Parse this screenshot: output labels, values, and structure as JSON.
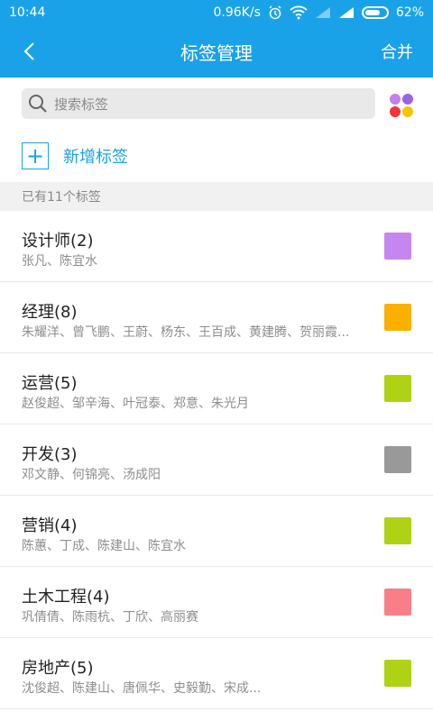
{
  "status_bar": {
    "time": "10:44",
    "speed": "0.96K/s",
    "battery": "62%"
  },
  "header": {
    "title": "标签管理",
    "merge_label": "合并"
  },
  "search": {
    "placeholder": "搜索标签"
  },
  "add": {
    "label": "新增标签"
  },
  "count_text": "已有11个标签",
  "palette": [
    "#c57df0",
    "#9a63e8",
    "#f5313b",
    "#f6c400"
  ],
  "tags": [
    {
      "title": "设计师(2)",
      "members": "张凡、陈宜水",
      "color": "#c586ef"
    },
    {
      "title": "经理(8)",
      "members": "朱耀洋、曾飞鹏、王蔚、杨东、王百成、黄建腾、贺丽霞...",
      "color": "#fbb000"
    },
    {
      "title": "运营(5)",
      "members": "赵俊超、邹辛海、叶冠泰、郑意、朱光月",
      "color": "#b0d215"
    },
    {
      "title": "开发(3)",
      "members": "邓文静、何锦亮、汤成阳",
      "color": "#999999"
    },
    {
      "title": "营销(4)",
      "members": "陈蕙、丁成、陈建山、陈宜水",
      "color": "#b0d215"
    },
    {
      "title": "土木工程(4)",
      "members": "巩倩倩、陈雨杭、丁欣、高丽赛",
      "color": "#f87e89"
    },
    {
      "title": "房地产(5)",
      "members": "沈俊超、陈建山、唐佩华、史毅勤、宋成...",
      "color": "#b0d215"
    }
  ]
}
